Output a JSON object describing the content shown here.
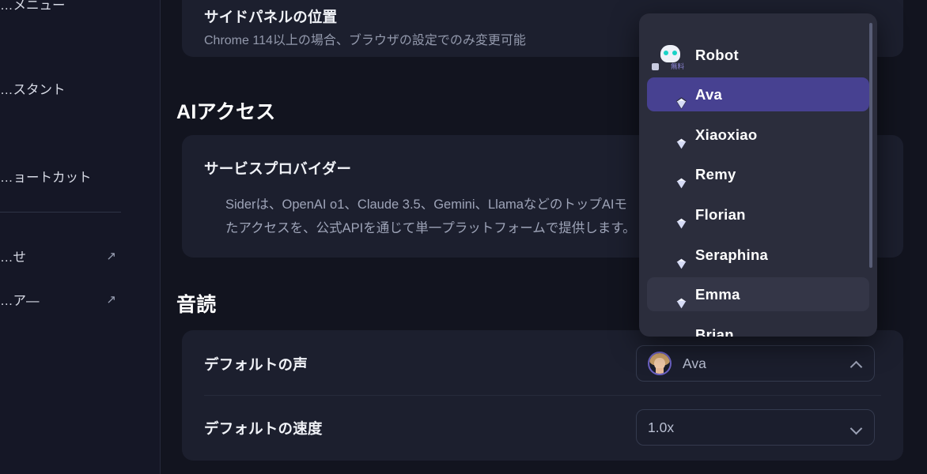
{
  "sidebar": {
    "items": [
      {
        "label": "…メニュー",
        "external": false
      },
      {
        "label": "…スタント",
        "external": false
      },
      {
        "label": "…ョートカット",
        "external": false
      },
      {
        "label": "…せ",
        "external": true,
        "icon": "external-link-icon"
      },
      {
        "label": "…ア―",
        "external": true,
        "icon": "external-link-icon"
      }
    ]
  },
  "main": {
    "side_panel_row": {
      "title": "サイドパネルの位置",
      "subtitle": "Chrome 114以上の場合、ブラウザの設定でのみ変更可能"
    },
    "ai_access": {
      "heading": "AIアクセス",
      "provider_title": "サービスプロバイダー",
      "description_line1": "Siderは、OpenAI o1、Claude 3.5、Gemini、LlamaなどのトップAIモ",
      "description_line2": "たアクセスを、公式APIを通じて単一プラットフォームで提供します。"
    },
    "read_aloud": {
      "heading": "音読",
      "voice_row_title": "デフォルトの声",
      "speed_row_title": "デフォルトの速度",
      "voice_select_value": "Ava",
      "voice_select_chevron": "chevron-up-icon",
      "speed_select_value": "1.0x",
      "speed_select_chevron": "chevron-down-icon"
    }
  },
  "voice_dropdown": {
    "scrollbar": "vertical-scrollbar",
    "options": [
      {
        "name": "Robot",
        "state": "normal",
        "badge": "無料",
        "badge_type": "free",
        "avatar": "robot-avatar"
      },
      {
        "name": "Ava",
        "state": "selected",
        "badge": "premium",
        "badge_type": "premium",
        "avatar": "ava-avatar"
      },
      {
        "name": "Xiaoxiao",
        "state": "normal",
        "badge": "premium",
        "badge_type": "premium",
        "avatar": "xiaoxiao-avatar"
      },
      {
        "name": "Remy",
        "state": "normal",
        "badge": "premium",
        "badge_type": "premium",
        "avatar": "remy-avatar"
      },
      {
        "name": "Florian",
        "state": "normal",
        "badge": "premium",
        "badge_type": "premium",
        "avatar": "florian-avatar"
      },
      {
        "name": "Seraphina",
        "state": "normal",
        "badge": "premium",
        "badge_type": "premium",
        "avatar": "seraphina-avatar"
      },
      {
        "name": "Emma",
        "state": "hovered",
        "badge": "premium",
        "badge_type": "premium",
        "avatar": "emma-avatar"
      },
      {
        "name": "Brian",
        "state": "normal",
        "badge": "premium",
        "badge_type": "premium",
        "avatar": "brian-avatar"
      }
    ]
  },
  "colors": {
    "page_background": "#12141f",
    "sidebar_background": "#151726",
    "card_background": "#1c1f2e",
    "panel_background": "#2b2d3c",
    "selected_row": "#474191",
    "hovered_row": "#343647",
    "accent_purple": "#6a5fc0",
    "text_primary": "#ffffff",
    "text_secondary": "#9399ac"
  }
}
